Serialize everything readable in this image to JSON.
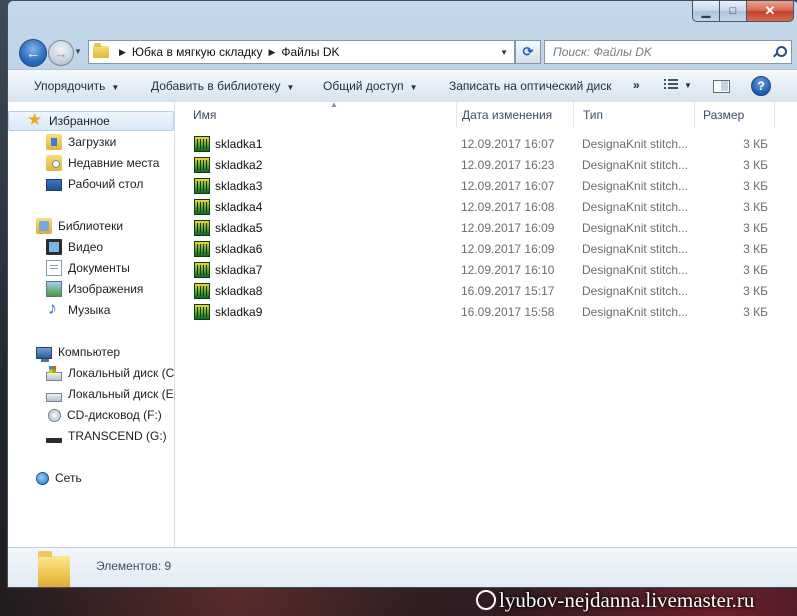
{
  "window": {
    "caption_buttons": {
      "minimize_glyph": "▁",
      "maximize_glyph": "□",
      "close_glyph": "✕"
    }
  },
  "navbar": {
    "back_glyph": "←",
    "forward_glyph": "→",
    "breadcrumbs": [
      "Юбка в мягкую складку",
      "Файлы DK"
    ],
    "refresh_glyph": "⟳",
    "search_placeholder": "Поиск: Файлы DK"
  },
  "toolbar": {
    "organize": "Упорядочить",
    "add_to_library": "Добавить в библиотеку",
    "share": "Общий доступ",
    "burn": "Записать на оптический диск",
    "more": "»",
    "help": "?"
  },
  "navpane": {
    "favorites": {
      "label": "Избранное",
      "icon": "star-icon"
    },
    "favorites_items": [
      {
        "label": "Загрузки",
        "icon": "downloads-icon"
      },
      {
        "label": "Недавние места",
        "icon": "recent-places-icon"
      },
      {
        "label": "Рабочий стол",
        "icon": "desktop-icon"
      }
    ],
    "libraries": {
      "label": "Библиотеки",
      "icon": "libraries-icon"
    },
    "libraries_items": [
      {
        "label": "Видео",
        "icon": "video-icon"
      },
      {
        "label": "Документы",
        "icon": "documents-icon"
      },
      {
        "label": "Изображения",
        "icon": "images-icon"
      },
      {
        "label": "Музыка",
        "icon": "music-icon"
      }
    ],
    "computer": {
      "label": "Компьютер",
      "icon": "computer-icon"
    },
    "computer_items": [
      {
        "label": "Локальный диск (C",
        "icon": "local-disk-icon"
      },
      {
        "label": "Локальный диск (E:",
        "icon": "local-disk-icon"
      },
      {
        "label": "CD-дисковод (F:)",
        "icon": "cd-drive-icon"
      },
      {
        "label": "TRANSCEND (G:)",
        "icon": "usb-drive-icon"
      }
    ],
    "network": {
      "label": "Сеть",
      "icon": "network-icon"
    }
  },
  "filelist": {
    "columns": {
      "name": "Имя",
      "date": "Дата изменения",
      "type": "Тип",
      "size": "Размер"
    },
    "sort_glyph": "▲",
    "files": [
      {
        "name": "skladka1",
        "date": "12.09.2017 16:07",
        "type": "DesignaKnit stitch...",
        "size": "3 КБ"
      },
      {
        "name": "skladka2",
        "date": "12.09.2017 16:23",
        "type": "DesignaKnit stitch...",
        "size": "3 КБ"
      },
      {
        "name": "skladka3",
        "date": "12.09.2017 16:07",
        "type": "DesignaKnit stitch...",
        "size": "3 КБ"
      },
      {
        "name": "skladka4",
        "date": "12.09.2017 16:08",
        "type": "DesignaKnit stitch...",
        "size": "3 КБ"
      },
      {
        "name": "skladka5",
        "date": "12.09.2017 16:09",
        "type": "DesignaKnit stitch...",
        "size": "3 КБ"
      },
      {
        "name": "skladka6",
        "date": "12.09.2017 16:09",
        "type": "DesignaKnit stitch...",
        "size": "3 КБ"
      },
      {
        "name": "skladka7",
        "date": "12.09.2017 16:10",
        "type": "DesignaKnit stitch...",
        "size": "3 КБ"
      },
      {
        "name": "skladka8",
        "date": "16.09.2017 15:17",
        "type": "DesignaKnit stitch...",
        "size": "3 КБ"
      },
      {
        "name": "skladka9",
        "date": "16.09.2017 15:58",
        "type": "DesignaKnit stitch...",
        "size": "3 КБ"
      }
    ]
  },
  "details": {
    "count": "Элементов: 9"
  },
  "watermark": "lyubov-nejdanna.livemaster.ru"
}
